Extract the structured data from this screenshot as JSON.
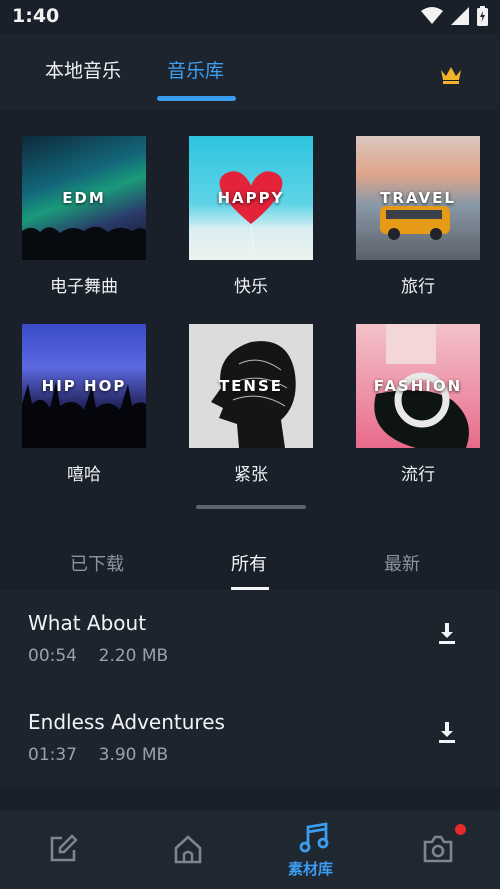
{
  "status_bar": {
    "time": "1:40"
  },
  "header": {
    "tabs": [
      {
        "label": "本地音乐",
        "active": false
      },
      {
        "label": "音乐库",
        "active": true
      }
    ],
    "accent_color": "#3c9cf0",
    "premium_icon": "crown-icon"
  },
  "categories": [
    {
      "tile_text": "EDM",
      "name": "电子舞曲"
    },
    {
      "tile_text": "HAPPY",
      "name": "快乐"
    },
    {
      "tile_text": "TRAVEL",
      "name": "旅行"
    },
    {
      "tile_text": "HIP HOP",
      "name": "嘻哈"
    },
    {
      "tile_text": "TENSE",
      "name": "紧张"
    },
    {
      "tile_text": "FASHION",
      "name": "流行"
    }
  ],
  "filters": {
    "tabs": [
      {
        "label": "已下载",
        "active": false
      },
      {
        "label": "所有",
        "active": true
      },
      {
        "label": "最新",
        "active": false
      }
    ]
  },
  "songs": [
    {
      "title": "What About",
      "duration": "00:54",
      "size": "2.20 MB"
    },
    {
      "title": "Endless Adventures",
      "duration": "01:37",
      "size": "3.90 MB"
    }
  ],
  "bottom_nav": {
    "items": [
      {
        "icon": "edit-icon",
        "label": ""
      },
      {
        "icon": "home-icon",
        "label": ""
      },
      {
        "icon": "music-note-icon",
        "label": "素材库",
        "active": true
      },
      {
        "icon": "camera-icon",
        "label": "",
        "badge": true
      }
    ]
  }
}
